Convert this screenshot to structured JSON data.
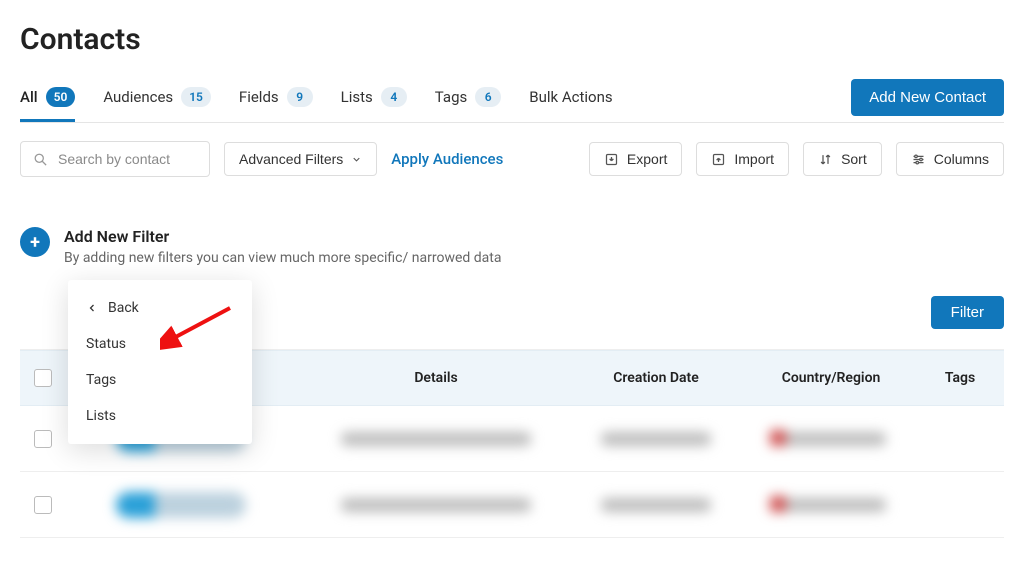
{
  "page_title": "Contacts",
  "tabs": [
    {
      "label": "All",
      "count": "50",
      "active": true
    },
    {
      "label": "Audiences",
      "count": "15",
      "active": false
    },
    {
      "label": "Fields",
      "count": "9",
      "active": false
    },
    {
      "label": "Lists",
      "count": "4",
      "active": false
    },
    {
      "label": "Tags",
      "count": "6",
      "active": false
    },
    {
      "label": "Bulk Actions",
      "count": "",
      "active": false
    }
  ],
  "add_button": "Add New Contact",
  "search": {
    "placeholder": "Search by contact"
  },
  "toolbar": {
    "advanced": "Advanced Filters",
    "apply": "Apply Audiences",
    "export": "Export",
    "import": "Import",
    "sort": "Sort",
    "columns": "Columns"
  },
  "filter_box": {
    "title": "Add New Filter",
    "subtitle": "By adding new filters you can view much more specific/ narrowed data"
  },
  "popover": {
    "back": "Back",
    "items": [
      "Status",
      "Tags",
      "Lists"
    ]
  },
  "filter_button": "Filter",
  "columns": [
    "",
    "",
    "Details",
    "Creation Date",
    "Country/Region",
    "Tags"
  ]
}
